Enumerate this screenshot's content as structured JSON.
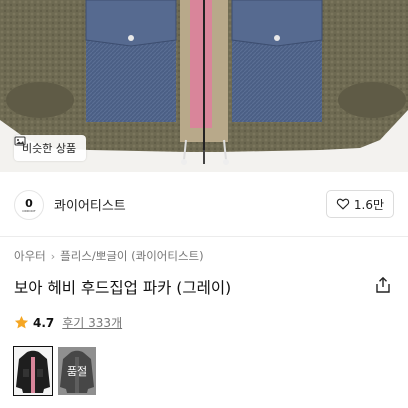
{
  "photo": {
    "similar_label": "비슷한 상품",
    "similar_icon": "image-icon"
  },
  "seller": {
    "logo_letter": "0",
    "logo_sub": "ODDOOT",
    "name": "콰이어티스트",
    "like_count": "1.6만",
    "like_icon": "heart-outline-icon"
  },
  "breadcrumb": [
    "아우터",
    "플리스/뽀글이 (콰이어티스트)"
  ],
  "product": {
    "title": "보아 헤비 후드집업 파카 (그레이)",
    "share_icon": "share-icon"
  },
  "rating": {
    "score": "4.7",
    "reviews_label": "후기 333개",
    "star_color": "#f5a623"
  },
  "options": [
    {
      "name": "black-pink",
      "soldout": ""
    },
    {
      "name": "gray",
      "soldout": "품절"
    }
  ],
  "colors": {
    "fleece": "#6e6a52",
    "denim": "#4b5f85",
    "zipper_pink": "#d9859a",
    "accent_star": "#f5a623"
  }
}
